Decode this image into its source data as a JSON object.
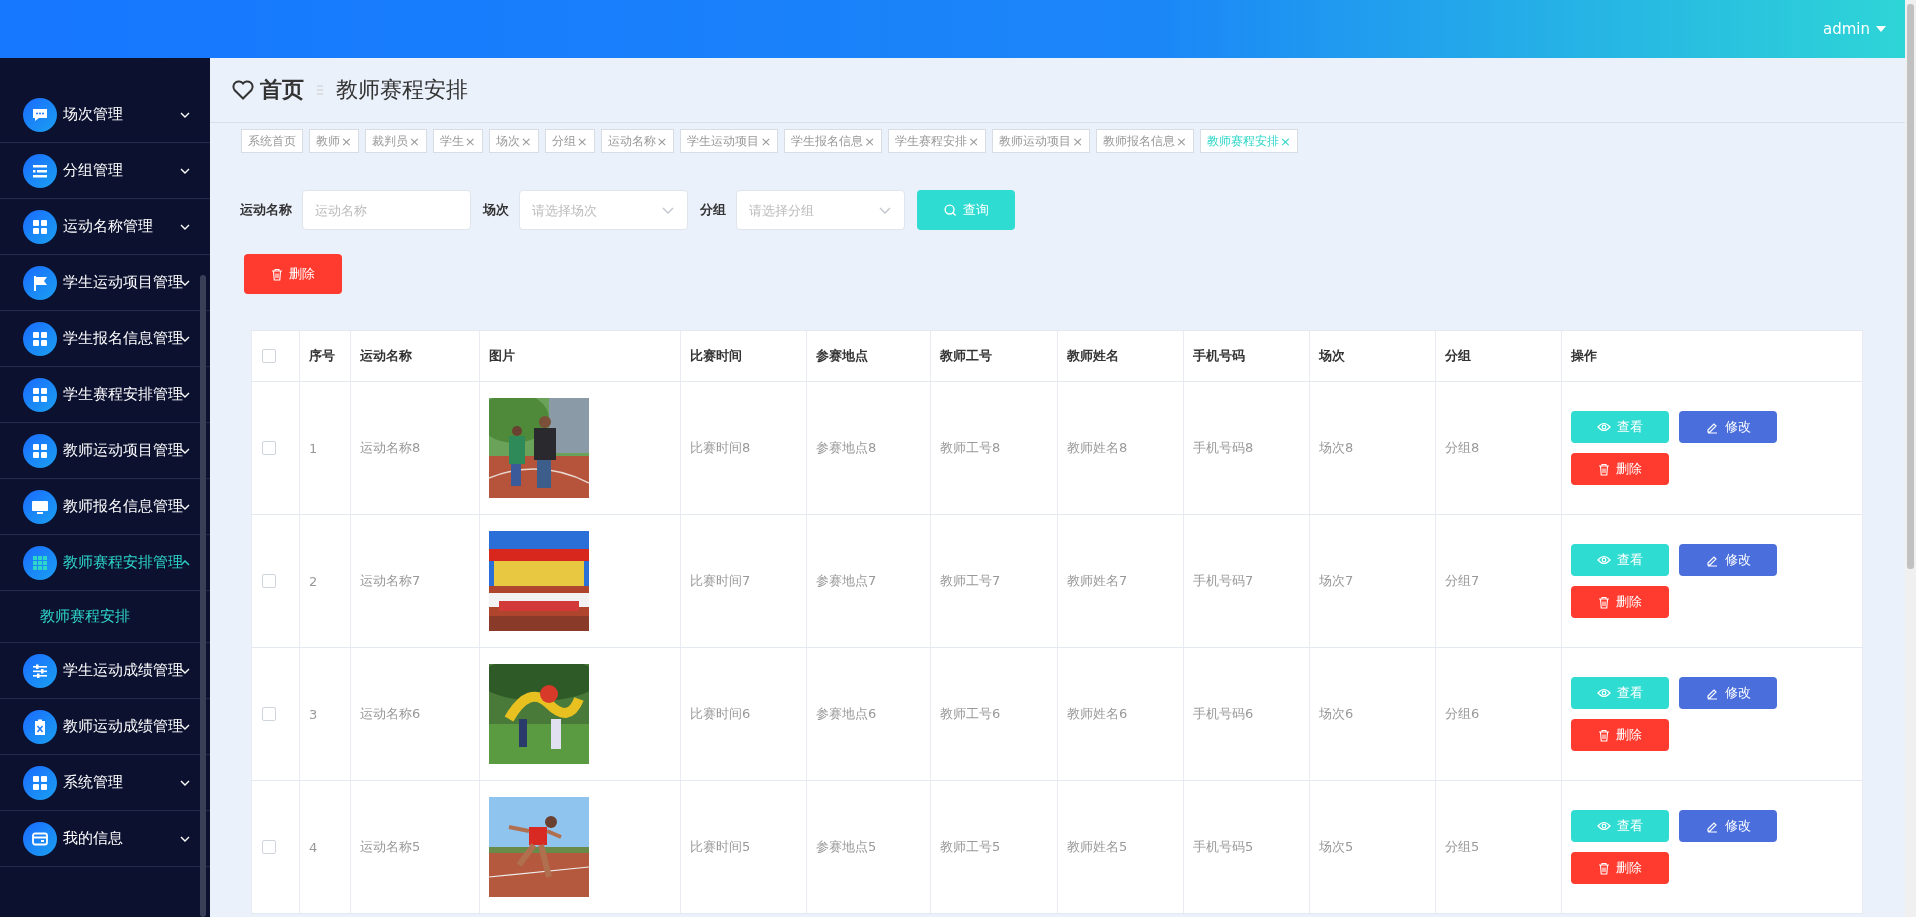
{
  "header": {
    "user": "admin"
  },
  "sidebar": {
    "items": [
      {
        "label": "场次管理",
        "expanded": false,
        "selected": false
      },
      {
        "label": "分组管理",
        "expanded": false,
        "selected": false
      },
      {
        "label": "运动名称管理",
        "expanded": false,
        "selected": false
      },
      {
        "label": "学生运动项目管理",
        "expanded": false,
        "selected": false
      },
      {
        "label": "学生报名信息管理",
        "expanded": false,
        "selected": false
      },
      {
        "label": "学生赛程安排管理",
        "expanded": false,
        "selected": false
      },
      {
        "label": "教师运动项目管理",
        "expanded": false,
        "selected": false
      },
      {
        "label": "教师报名信息管理",
        "expanded": false,
        "selected": false
      },
      {
        "label": "教师赛程安排管理",
        "expanded": true,
        "selected": true,
        "children": [
          {
            "label": "教师赛程安排",
            "selected": true
          }
        ]
      },
      {
        "label": "学生运动成绩管理",
        "expanded": false,
        "selected": false
      },
      {
        "label": "教师运动成绩管理",
        "expanded": false,
        "selected": false
      },
      {
        "label": "系统管理",
        "expanded": false,
        "selected": false
      },
      {
        "label": "我的信息",
        "expanded": false,
        "selected": false
      }
    ]
  },
  "breadcrumb": {
    "home": "首页",
    "current": "教师赛程安排"
  },
  "tabs": [
    {
      "label": "系统首页",
      "selected": false
    },
    {
      "label": "教师",
      "close": "×",
      "selected": false
    },
    {
      "label": "裁判员",
      "close": "×",
      "selected": false
    },
    {
      "label": "学生",
      "close": "×",
      "selected": false
    },
    {
      "label": "场次",
      "close": "×",
      "selected": false
    },
    {
      "label": "分组",
      "close": "×",
      "selected": false
    },
    {
      "label": "运动名称",
      "close": "×",
      "selected": false
    },
    {
      "label": "学生运动项目",
      "close": "×",
      "selected": false
    },
    {
      "label": "学生报名信息",
      "close": "×",
      "selected": false
    },
    {
      "label": "学生赛程安排",
      "close": "×",
      "selected": false
    },
    {
      "label": "教师运动项目",
      "close": "×",
      "selected": false
    },
    {
      "label": "教师报名信息",
      "close": "×",
      "selected": false
    },
    {
      "label": "教师赛程安排",
      "close": "×",
      "selected": true
    }
  ],
  "search": {
    "fields": [
      {
        "label": "运动名称",
        "kind": "input",
        "placeholder": "运动名称"
      },
      {
        "label": "场次",
        "kind": "select",
        "placeholder": "请选择场次"
      },
      {
        "label": "分组",
        "kind": "select",
        "placeholder": "请选择分组"
      }
    ],
    "button": "查询"
  },
  "delete_button": "删除",
  "table": {
    "select_all": {
      "checked": false
    },
    "columns": [
      "序号",
      "运动名称",
      "图片",
      "比赛时间",
      "参赛地点",
      "教师工号",
      "教师姓名",
      "手机号码",
      "场次",
      "分组",
      "操作"
    ],
    "rows": [
      {
        "checked": false,
        "cells": [
          "1",
          "运动名称8",
          {
            "kind": "picture"
          },
          "比赛时间8",
          "参赛地点8",
          "教师工号8",
          "教师姓名8",
          "手机号码8",
          "场次8",
          "分组8"
        ],
        "actions": [
          {
            "label": "查看",
            "kind": "view"
          },
          {
            "label": "修改",
            "kind": "edit"
          },
          {
            "label": "删除",
            "kind": "delete"
          }
        ]
      },
      {
        "checked": false,
        "cells": [
          "2",
          "运动名称7",
          {
            "kind": "picture"
          },
          "比赛时间7",
          "参赛地点7",
          "教师工号7",
          "教师姓名7",
          "手机号码7",
          "场次7",
          "分组7"
        ],
        "actions": [
          {
            "label": "查看",
            "kind": "view"
          },
          {
            "label": "修改",
            "kind": "edit"
          },
          {
            "label": "删除",
            "kind": "delete"
          }
        ]
      },
      {
        "checked": false,
        "cells": [
          "3",
          "运动名称6",
          {
            "kind": "picture"
          },
          "比赛时间6",
          "参赛地点6",
          "教师工号6",
          "教师姓名6",
          "手机号码6",
          "场次6",
          "分组6"
        ],
        "actions": [
          {
            "label": "查看",
            "kind": "view"
          },
          {
            "label": "修改",
            "kind": "edit"
          },
          {
            "label": "删除",
            "kind": "delete"
          }
        ]
      },
      {
        "checked": false,
        "cells": [
          "4",
          "运动名称5",
          {
            "kind": "picture"
          },
          "比赛时间5",
          "参赛地点5",
          "教师工号5",
          "教师姓名5",
          "手机号码5",
          "场次5",
          "分组5"
        ],
        "actions": [
          {
            "label": "查看",
            "kind": "view"
          },
          {
            "label": "修改",
            "kind": "edit"
          },
          {
            "label": "删除",
            "kind": "delete"
          }
        ]
      }
    ]
  }
}
